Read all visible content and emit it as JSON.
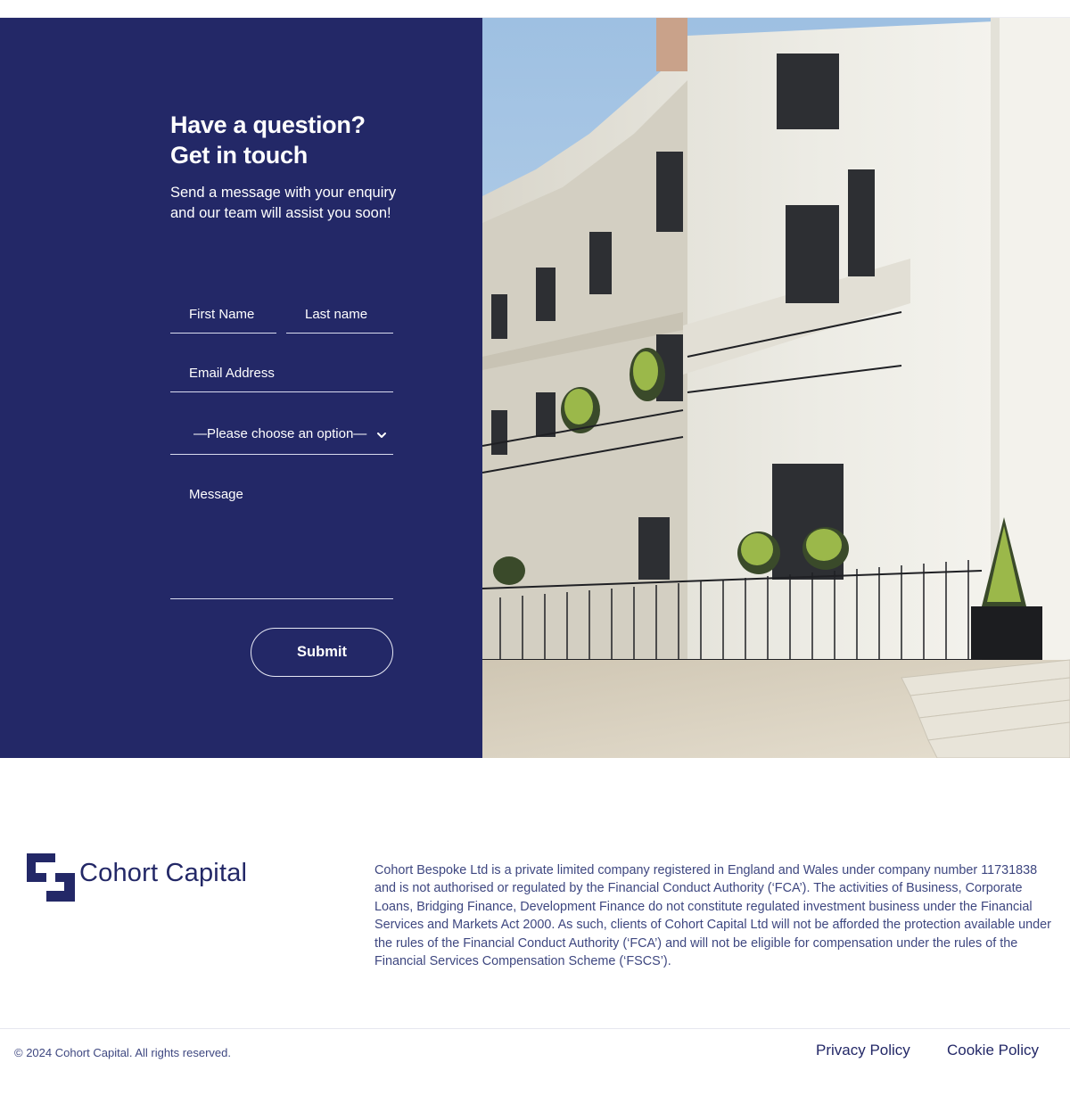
{
  "contact": {
    "heading_line1": "Have a question?",
    "heading_line2": "Get in touch",
    "intro": "Send a message with your enquiry and our team will assist you soon!",
    "form": {
      "first_name_placeholder": "First Name",
      "last_name_placeholder": "Last name",
      "email_placeholder": "Email Address",
      "select_value": "—Please choose an option—",
      "message_placeholder": "Message",
      "submit_label": "Submit"
    }
  },
  "footer": {
    "logo_text": "Cohort Capital",
    "disclaimer": "Cohort Bespoke Ltd is a private limited company registered in England and Wales under company number 11731838 and is not authorised or regulated by the Financial Conduct Authority (‘FCA’). The activities of Business, Corporate Loans, Bridging Finance, Development Finance do not constitute regulated investment business under the Financial Services and Markets Act 2000. As such, clients of Cohort Capital Ltd will not be afforded the protection available under the rules of the Financial Conduct Authority (‘FCA’) and will not be eligible for compensation under the rules of the Financial Services Compensation Scheme (‘FSCS’).",
    "copyright": "© 2024 Cohort Capital. All rights reserved.",
    "links": {
      "privacy": "Privacy Policy",
      "cookie": "Cookie Policy"
    }
  },
  "colors": {
    "brand_navy": "#232867",
    "footer_text": "#3e4780",
    "white": "#ffffff"
  },
  "icons": {
    "select_chevron": "chevron-down-icon",
    "logo_mark": "cohort-capital-logo-icon"
  }
}
